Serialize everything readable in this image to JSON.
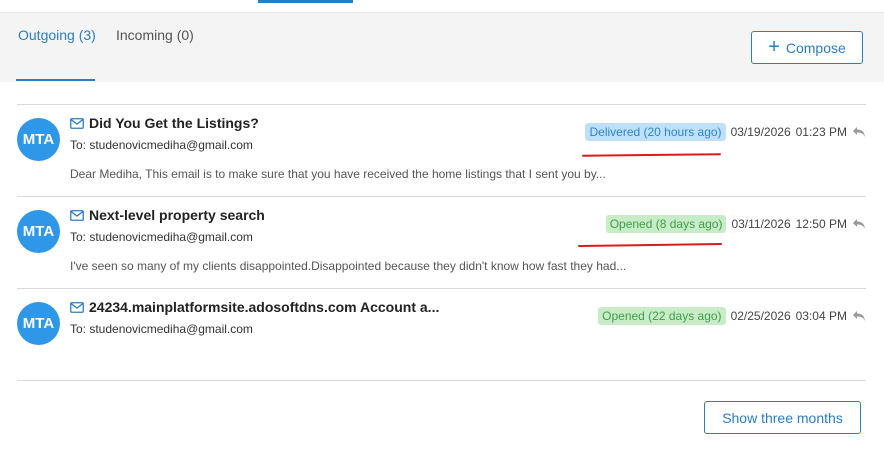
{
  "tabs": [
    {
      "label": "Outgoing (3)",
      "active": true
    },
    {
      "label": "Incoming (0)",
      "active": false
    }
  ],
  "compose": {
    "label": "Compose",
    "icon": "plus-icon"
  },
  "colors": {
    "accent": "#2b7dc1",
    "avatar": "#2f97e8",
    "delivered_bg": "#bfe0fb",
    "opened_bg": "#c8ecc8",
    "annotation": "#d91c1c"
  },
  "emails": [
    {
      "avatar": "MTA",
      "subject": "Did You Get the Listings?",
      "to": "To: studenovicmediha@gmail.com",
      "preview": "Dear Mediha, This email is to make sure that you have received the home listings that I sent you by...",
      "status": "Delivered (20 hours ago)",
      "date": "03/19/2026",
      "time": "01:23 PM"
    },
    {
      "avatar": "MTA",
      "subject": "Next-level property search",
      "to": "To: studenovicmediha@gmail.com",
      "preview": "I've seen so many of my clients disappointed.Disappointed because they didn't know how fast they had...",
      "status": "Opened (8 days ago)",
      "date": "03/11/2026",
      "time": "12:50 PM"
    },
    {
      "avatar": "MTA",
      "subject": "24234.mainplatformsite.adosoftdns.com Account a...",
      "to": "To: studenovicmediha@gmail.com",
      "preview": "",
      "status": "Opened (22 days ago)",
      "date": "02/25/2026",
      "time": "03:04 PM"
    }
  ],
  "footer": {
    "button_label": "Show three months"
  }
}
